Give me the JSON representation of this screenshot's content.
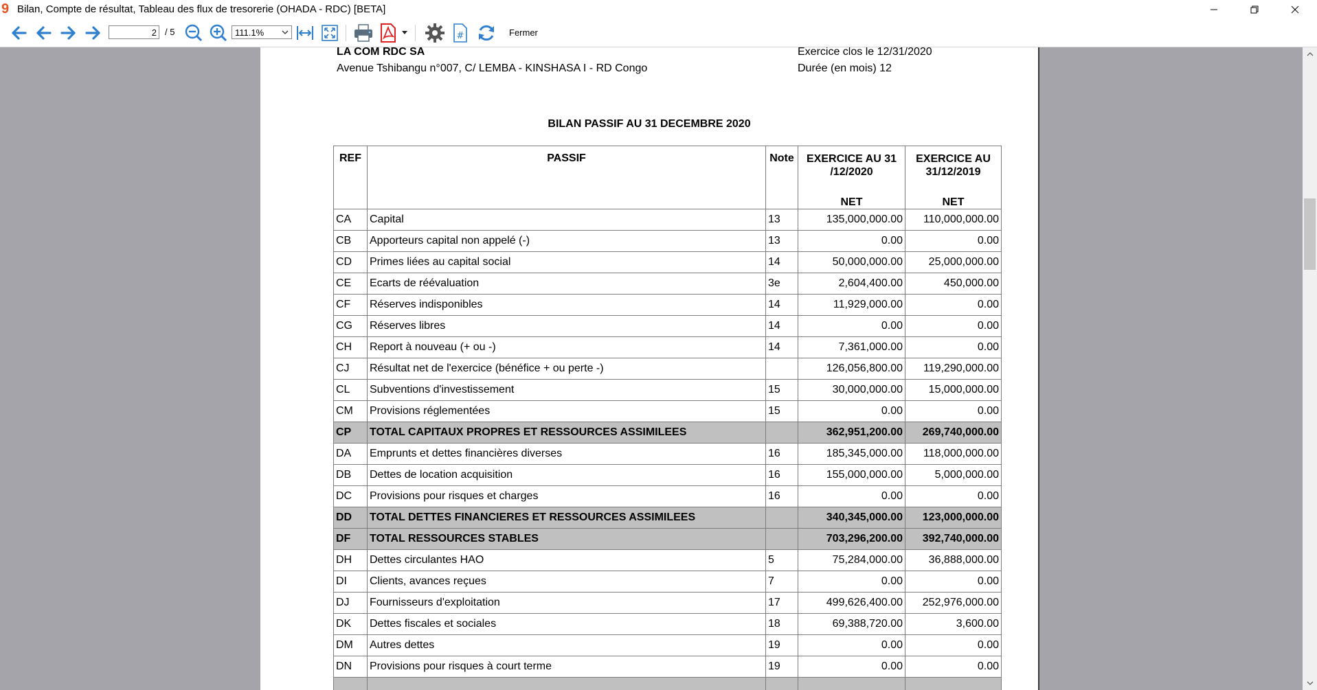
{
  "window": {
    "title": "Bilan, Compte de résultat, Tableau des flux de tresorerie (OHADA - RDC) [BETA]",
    "logo": "9",
    "controls": [
      "minimize-icon",
      "restore-icon",
      "close-icon"
    ]
  },
  "toolbar": {
    "page_current": "2",
    "page_total": "/ 5",
    "zoom": "111.1%",
    "close_label": "Fermer",
    "accent_color": "#2e7fd0",
    "pdf_color": "#e02020"
  },
  "document": {
    "company": "LA COM  RDC SA",
    "address": "Avenue Tshibangu n°007, C/ LEMBA - KINSHASA I - RD Congo",
    "period": "Exercice clos le 12/31/2020",
    "duration": "Durée (en mois) 12",
    "title": "BILAN PASSIF AU 31 DECEMBRE 2020",
    "table": {
      "headers": {
        "ref": "REF",
        "passif": "PASSIF",
        "note": "Note",
        "ex1": "EXERCICE AU 31 /12/2020",
        "ex2": "EXERCICE AU 31/12/2019",
        "net1": "NET",
        "net2": "NET"
      },
      "rows": [
        {
          "ref": "CA",
          "label": "Capital",
          "note": "13",
          "v2020": "135,000,000.00",
          "v2019": "110,000,000.00",
          "total": false
        },
        {
          "ref": "CB",
          "label": "Apporteurs capital non appelé (-)",
          "note": "13",
          "v2020": "0.00",
          "v2019": "0.00",
          "total": false
        },
        {
          "ref": "CD",
          "label": "Primes liées au capital social",
          "note": "14",
          "v2020": "50,000,000.00",
          "v2019": "25,000,000.00",
          "total": false
        },
        {
          "ref": "CE",
          "label": "Ecarts de réévaluation",
          "note": "3e",
          "v2020": "2,604,400.00",
          "v2019": "450,000.00",
          "total": false
        },
        {
          "ref": "CF",
          "label": "Réserves indisponibles",
          "note": "14",
          "v2020": "11,929,000.00",
          "v2019": "0.00",
          "total": false
        },
        {
          "ref": "CG",
          "label": "Réserves libres",
          "note": "14",
          "v2020": "0.00",
          "v2019": "0.00",
          "total": false
        },
        {
          "ref": "CH",
          "label": "Report à nouveau (+ ou -)",
          "note": "14",
          "v2020": "7,361,000.00",
          "v2019": "0.00",
          "total": false
        },
        {
          "ref": "CJ",
          "label": "Résultat net de l'exercice (bénéfice + ou perte -)",
          "note": "",
          "v2020": "126,056,800.00",
          "v2019": "119,290,000.00",
          "total": false
        },
        {
          "ref": "CL",
          "label": "Subventions d'investissement",
          "note": "15",
          "v2020": "30,000,000.00",
          "v2019": "15,000,000.00",
          "total": false
        },
        {
          "ref": "CM",
          "label": "Provisions réglementées",
          "note": "15",
          "v2020": "0.00",
          "v2019": "0.00",
          "total": false
        },
        {
          "ref": "CP",
          "label": "TOTAL CAPITAUX PROPRES ET RESSOURCES ASSIMILEES",
          "note": "",
          "v2020": "362,951,200.00",
          "v2019": "269,740,000.00",
          "total": true
        },
        {
          "ref": "DA",
          "label": "Emprunts et dettes financières diverses",
          "note": "16",
          "v2020": "185,345,000.00",
          "v2019": "118,000,000.00",
          "total": false
        },
        {
          "ref": "DB",
          "label": "Dettes de location acquisition",
          "note": "16",
          "v2020": "155,000,000.00",
          "v2019": "5,000,000.00",
          "total": false
        },
        {
          "ref": "DC",
          "label": "Provisions pour risques et charges",
          "note": "16",
          "v2020": "0.00",
          "v2019": "0.00",
          "total": false
        },
        {
          "ref": "DD",
          "label": "TOTAL DETTES FINANCIERES ET RESSOURCES ASSIMILEES",
          "note": "",
          "v2020": "340,345,000.00",
          "v2019": "123,000,000.00",
          "total": true
        },
        {
          "ref": "DF",
          "label": "TOTAL RESSOURCES STABLES",
          "note": "",
          "v2020": "703,296,200.00",
          "v2019": "392,740,000.00",
          "total": true
        },
        {
          "ref": "DH",
          "label": "Dettes circulantes HAO",
          "note": "5",
          "v2020": "75,284,000.00",
          "v2019": "36,888,000.00",
          "total": false
        },
        {
          "ref": "DI",
          "label": "Clients, avances reçues",
          "note": "7",
          "v2020": "0.00",
          "v2019": "0.00",
          "total": false
        },
        {
          "ref": "DJ",
          "label": "Fournisseurs d'exploitation",
          "note": "17",
          "v2020": "499,626,400.00",
          "v2019": "252,976,000.00",
          "total": false
        },
        {
          "ref": "DK",
          "label": "Dettes fiscales et sociales",
          "note": "18",
          "v2020": "69,388,720.00",
          "v2019": "3,600.00",
          "total": false
        },
        {
          "ref": "DM",
          "label": "Autres dettes",
          "note": "19",
          "v2020": "0.00",
          "v2019": "0.00",
          "total": false
        },
        {
          "ref": "DN",
          "label": "Provisions pour risques à court terme",
          "note": "19",
          "v2020": "0.00",
          "v2019": "0.00",
          "total": false
        },
        {
          "ref": "",
          "label": "",
          "note": "",
          "v2020": "",
          "v2019": "",
          "total": true
        }
      ]
    }
  }
}
